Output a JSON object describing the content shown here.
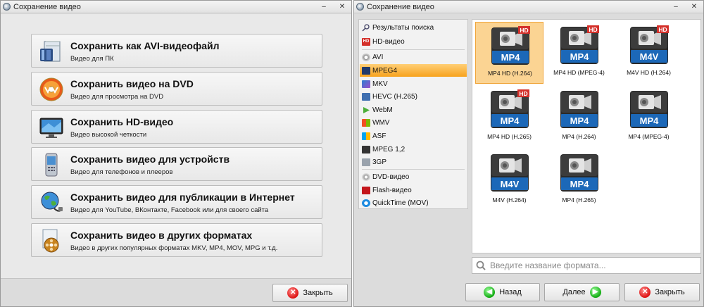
{
  "left_window": {
    "title": "Сохранение видео",
    "options": [
      {
        "title": "Сохранить как AVI-видеофайл",
        "subtitle": "Видео для ПК",
        "icon": "avi-file-icon"
      },
      {
        "title": "Сохранить видео на DVD",
        "subtitle": "Видео для просмотра на DVD",
        "icon": "dvd-disc-icon"
      },
      {
        "title": "Сохранить HD-видео",
        "subtitle": "Видео высокой четкости",
        "icon": "hd-monitor-icon"
      },
      {
        "title": "Сохранить видео для устройств",
        "subtitle": "Видео для телефонов и плееров",
        "icon": "phone-icon"
      },
      {
        "title": "Сохранить видео для публикации в Интернет",
        "subtitle": "Видео для YouTube, ВКонтакте, Facebook или для своего сайта",
        "icon": "globe-icon"
      },
      {
        "title": "Сохранить видео в других форматах",
        "subtitle": "Видео в других популярных форматах MKV, MP4, MOV, MPG и т.д.",
        "icon": "film-reel-icon"
      }
    ],
    "close_label": "Закрыть"
  },
  "right_window": {
    "title": "Сохранение видео",
    "sidebar": [
      {
        "label": "Результаты поиска",
        "icon": "search-results-icon",
        "selected": false
      },
      {
        "label": "HD-видео",
        "icon": "hd-icon",
        "selected": false
      },
      {
        "label": "AVI",
        "icon": "avi-icon",
        "selected": false
      },
      {
        "label": "MPEG4",
        "icon": "mpeg4-icon",
        "selected": true
      },
      {
        "label": "MKV",
        "icon": "mkv-icon",
        "selected": false
      },
      {
        "label": "HEVC (H.265)",
        "icon": "hevc-icon",
        "selected": false
      },
      {
        "label": "WebM",
        "icon": "webm-icon",
        "selected": false
      },
      {
        "label": "WMV",
        "icon": "wmv-icon",
        "selected": false
      },
      {
        "label": "ASF",
        "icon": "asf-icon",
        "selected": false
      },
      {
        "label": "MPEG 1,2",
        "icon": "mpeg12-icon",
        "selected": false
      },
      {
        "label": "3GP",
        "icon": "3gp-icon",
        "selected": false
      },
      {
        "label": "DVD-видео",
        "icon": "dvd-icon",
        "selected": false
      },
      {
        "label": "Flash-видео",
        "icon": "flash-icon",
        "selected": false
      },
      {
        "label": "QuickTime (MOV)",
        "icon": "quicktime-icon",
        "selected": false
      }
    ],
    "formats": [
      {
        "badge": "MP4",
        "hd": true,
        "label": "MP4 HD (H.264)",
        "selected": true
      },
      {
        "badge": "MP4",
        "hd": true,
        "label": "MP4 HD (MPEG-4)",
        "selected": false
      },
      {
        "badge": "M4V",
        "hd": true,
        "label": "M4V HD (H.264)",
        "selected": false
      },
      {
        "badge": "MP4",
        "hd": true,
        "label": "MP4 HD (H.265)",
        "selected": false
      },
      {
        "badge": "MP4",
        "hd": false,
        "label": "MP4 (H.264)",
        "selected": false
      },
      {
        "badge": "MP4",
        "hd": false,
        "label": "MP4 (MPEG-4)",
        "selected": false
      },
      {
        "badge": "M4V",
        "hd": false,
        "label": "M4V (H.264)",
        "selected": false
      },
      {
        "badge": "MP4",
        "hd": false,
        "label": "MP4 (H.265)",
        "selected": false
      }
    ],
    "hd_badge": "HD",
    "search_placeholder": "Введите название формата...",
    "back_label": "Назад",
    "next_label": "Далее",
    "close_label": "Закрыть"
  },
  "window_controls": {
    "minimize": "–",
    "close": "✕"
  },
  "colors": {
    "selected_bg": "#fbd493",
    "selected_border": "#f0a53a",
    "accent_orange": "#f7a21e",
    "badge_blue": "#1c68b8",
    "hd_red": "#d4302a"
  }
}
